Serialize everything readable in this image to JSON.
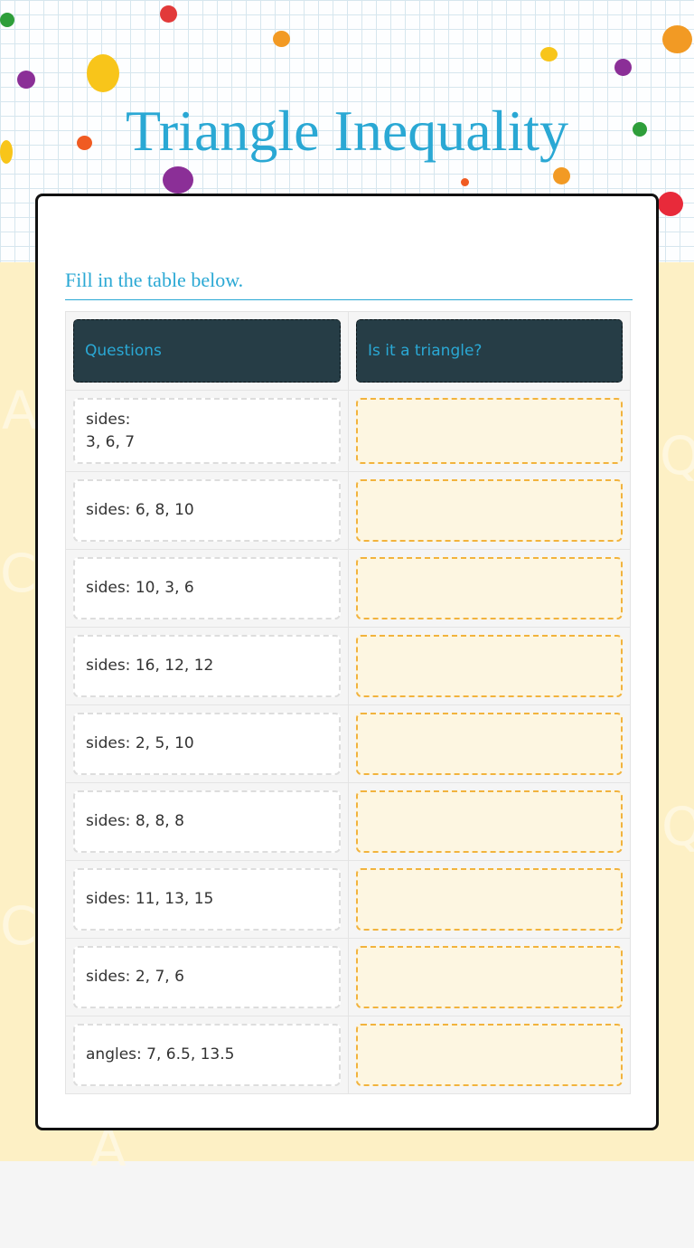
{
  "title": "Triangle Inequality",
  "instruction": "Fill in the table below.",
  "table": {
    "headers": [
      "Questions",
      "Is it a triangle?"
    ],
    "rows": [
      {
        "question": "sides:\n 3, 6, 7",
        "answer": ""
      },
      {
        "question": "sides: 6, 8, 10",
        "answer": ""
      },
      {
        "question": "sides: 10, 3, 6",
        "answer": ""
      },
      {
        "question": "sides: 16, 12, 12",
        "answer": ""
      },
      {
        "question": "sides: 2, 5, 10",
        "answer": ""
      },
      {
        "question": "sides: 8, 8, 8",
        "answer": ""
      },
      {
        "question": "sides: 11, 13, 15",
        "answer": ""
      },
      {
        "question": "sides: 2, 7, 6",
        "answer": ""
      },
      {
        "question": "angles: 7, 6.5, 13.5",
        "answer": ""
      }
    ]
  },
  "colors": {
    "accent": "#2aa8d4",
    "header_cell": "#263d46",
    "answer_border": "#f2b33d",
    "answer_fill": "#fdf6e1",
    "body_background": "#fdf0c5"
  }
}
